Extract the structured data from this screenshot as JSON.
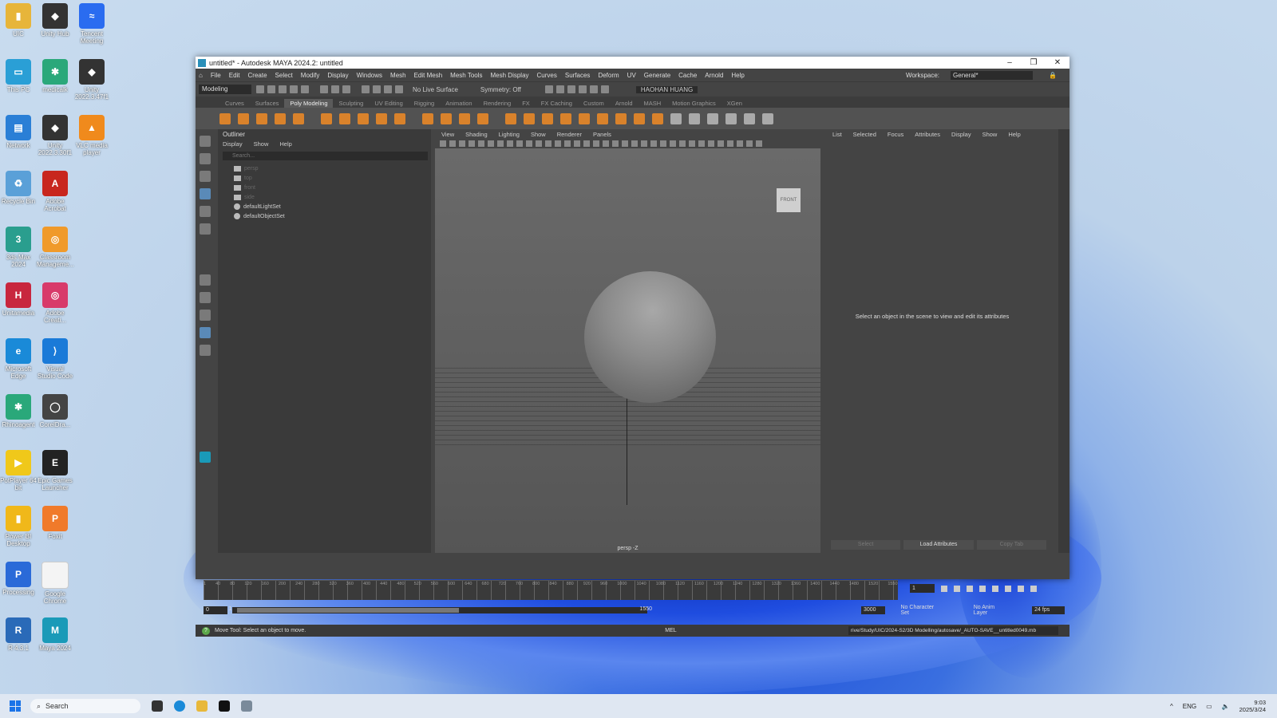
{
  "desktop_icons": [
    {
      "label": "UIC",
      "color": "#e7b53a",
      "glyph": "▮"
    },
    {
      "label": "Unity Hub",
      "color": "#333333",
      "glyph": "◆"
    },
    {
      "label": "Tencent Meeting",
      "color": "#2a6cf0",
      "glyph": "≈"
    },
    {
      "label": "This PC",
      "color": "#2a9fd6",
      "glyph": "▭"
    },
    {
      "label": "medicalk",
      "color": "#2aa87a",
      "glyph": "✱"
    },
    {
      "label": "Unity 2022.3.47f1",
      "color": "#333333",
      "glyph": "◆"
    },
    {
      "label": "Network",
      "color": "#2a7fd6",
      "glyph": "▤"
    },
    {
      "label": "Unity 2022.3.30f1",
      "color": "#333333",
      "glyph": "◆"
    },
    {
      "label": "VLC media player",
      "color": "#f08a1c",
      "glyph": "▲"
    },
    {
      "label": "Recycle Bin",
      "color": "#5aa0d8",
      "glyph": "♻"
    },
    {
      "label": "Adobe Acrobat",
      "color": "#c8261e",
      "glyph": "A"
    },
    {
      "label": "3ds Max 2024",
      "color": "#2a9e8e",
      "glyph": "3"
    },
    {
      "label": "Classroom Manageme...",
      "color": "#f09a2a",
      "glyph": "◎"
    },
    {
      "label": "Unitamedia",
      "color": "#c8263e",
      "glyph": "H"
    },
    {
      "label": "Adobe Creati...",
      "color": "#d83a6a",
      "glyph": "◎"
    },
    {
      "label": "Microsoft Edge",
      "color": "#1a8ad8",
      "glyph": "e"
    },
    {
      "label": "Visual Studio Code",
      "color": "#1a7ad8",
      "glyph": "⟩"
    },
    {
      "label": "Rhinoagent",
      "color": "#2aa87a",
      "glyph": "✱"
    },
    {
      "label": "CorelDra...",
      "color": "#444444",
      "glyph": "◯"
    },
    {
      "label": "PotPlayer 64 bit",
      "color": "#f0c81a",
      "glyph": "▶"
    },
    {
      "label": "Epic Games Launcher",
      "color": "#222222",
      "glyph": "E"
    },
    {
      "label": "Power BI Desktop",
      "color": "#f0b81a",
      "glyph": "▮"
    },
    {
      "label": "Foxit",
      "color": "#f07a2a",
      "glyph": "P"
    },
    {
      "label": "Processing",
      "color": "#2a6ad8",
      "glyph": "P"
    },
    {
      "label": "Google Chrome",
      "color": "#f4f4f4",
      "glyph": ""
    },
    {
      "label": "R 4.3.1",
      "color": "#2a6ab8",
      "glyph": "R"
    },
    {
      "label": "Maya 2024",
      "color": "#1a9ab8",
      "glyph": "M"
    }
  ],
  "window": {
    "title": "untitled* - Autodesk MAYA 2024.2: untitled",
    "controls": [
      "–",
      "❐",
      "✕"
    ]
  },
  "menubar": {
    "items": [
      "File",
      "Edit",
      "Create",
      "Select",
      "Modify",
      "Display",
      "Windows",
      "Mesh",
      "Edit Mesh",
      "Mesh Tools",
      "Mesh Display",
      "Curves",
      "Surfaces",
      "Deform",
      "UV",
      "Generate",
      "Cache",
      "Arnold",
      "Help"
    ],
    "workspace_label": "Workspace:",
    "workspace_value": "General*"
  },
  "statusline": {
    "mode": "Modeling",
    "live_surface": "No Live Surface",
    "symmetry": "Symmetry: Off",
    "user": "HAOHAN HUANG"
  },
  "shelf": {
    "tabs": [
      "Curves",
      "Surfaces",
      "Poly Modeling",
      "Sculpting",
      "UV Editing",
      "Rigging",
      "Animation",
      "Rendering",
      "FX",
      "FX Caching",
      "Custom",
      "Arnold",
      "MASH",
      "Motion Graphics",
      "XGen"
    ],
    "active_tab": "Poly Modeling"
  },
  "outliner": {
    "title": "Outliner",
    "menu": [
      "Display",
      "Show",
      "Help"
    ],
    "search_placeholder": "Search...",
    "rows": [
      {
        "label": "persp",
        "dim": true
      },
      {
        "label": "top",
        "dim": true
      },
      {
        "label": "front",
        "dim": true
      },
      {
        "label": "side",
        "dim": true
      },
      {
        "label": "defaultLightSet",
        "dim": false
      },
      {
        "label": "defaultObjectSet",
        "dim": false
      }
    ]
  },
  "viewport": {
    "menu": [
      "View",
      "Shading",
      "Lighting",
      "Show",
      "Renderer",
      "Panels"
    ],
    "view_cube": "FRONT",
    "camera": "persp -Z"
  },
  "attribute_editor": {
    "tabs": [
      "List",
      "Selected",
      "Focus",
      "Attributes",
      "Display",
      "Show",
      "Help"
    ],
    "message": "Select an object in the scene to view and edit its attributes",
    "buttons": [
      "Select",
      "Load Attributes",
      "Copy Tab"
    ]
  },
  "timeline": {
    "ticks": [
      "1",
      "40",
      "80",
      "120",
      "160",
      "200",
      "240",
      "280",
      "320",
      "360",
      "400",
      "440",
      "480",
      "520",
      "560",
      "600",
      "640",
      "680",
      "720",
      "760",
      "800",
      "840",
      "880",
      "920",
      "960",
      "1000",
      "1040",
      "1080",
      "1120",
      "1160",
      "1200",
      "1240",
      "1280",
      "1320",
      "1360",
      "1400",
      "1440",
      "1480",
      "1520",
      "1550"
    ],
    "current_frame": "1"
  },
  "range": {
    "start": "0",
    "range_start": "1",
    "range_end": "1550",
    "end": "3000",
    "character_set": "No Character Set",
    "anim_layer": "No Anim Layer",
    "fps": "24 fps"
  },
  "command_line": {
    "help_text": "Move Tool: Select an object to move.",
    "mel": "MEL",
    "path": "rive/Study/UIC/2024-S2/3D Modelling/autosave/_AUTO-SAVE__untitled0049.mb"
  },
  "taskbar": {
    "search": "Search",
    "lang": "ENG",
    "time": "9:03",
    "date": "2025/3/24"
  },
  "colors": {
    "maya_accent": "#5a8ab8",
    "shelf_icon": "#d9822b"
  }
}
